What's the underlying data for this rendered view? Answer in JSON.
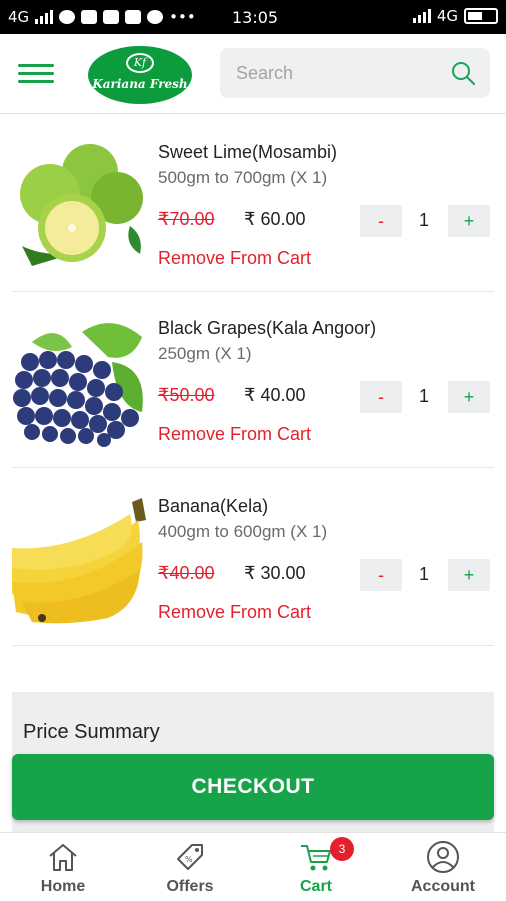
{
  "status_bar": {
    "network": "4G",
    "time": "13:05",
    "right_network": "4G"
  },
  "header": {
    "logo_monogram": "Kf",
    "logo_text": "Kariana Fresh",
    "search_placeholder": "Search"
  },
  "cart": {
    "items": [
      {
        "name": "Sweet Lime(Mosambi)",
        "qty_label": "500gm to 700gm (X 1)",
        "mrp": "₹70.00",
        "price": "₹ 60.00",
        "quantity": "1",
        "remove_label": "Remove From Cart",
        "minus": "-",
        "plus": "+"
      },
      {
        "name": "Black Grapes(Kala Angoor)",
        "qty_label": "250gm (X 1)",
        "mrp": "₹50.00",
        "price": "₹ 40.00",
        "quantity": "1",
        "remove_label": "Remove From Cart",
        "minus": "-",
        "plus": "+"
      },
      {
        "name": "Banana(Kela)",
        "qty_label": "400gm to 600gm (X 1)",
        "mrp": "₹40.00",
        "price": "₹ 30.00",
        "quantity": "1",
        "remove_label": "Remove From Cart",
        "minus": "-",
        "plus": "+"
      }
    ]
  },
  "summary": {
    "title": "Price Summary"
  },
  "checkout_label": "CHECKOUT",
  "bottom_nav": {
    "home": "Home",
    "offers": "Offers",
    "cart": "Cart",
    "cart_badge": "3",
    "account": "Account"
  },
  "colors": {
    "brand_green": "#17a24a",
    "discount_red": "#e5202e"
  }
}
